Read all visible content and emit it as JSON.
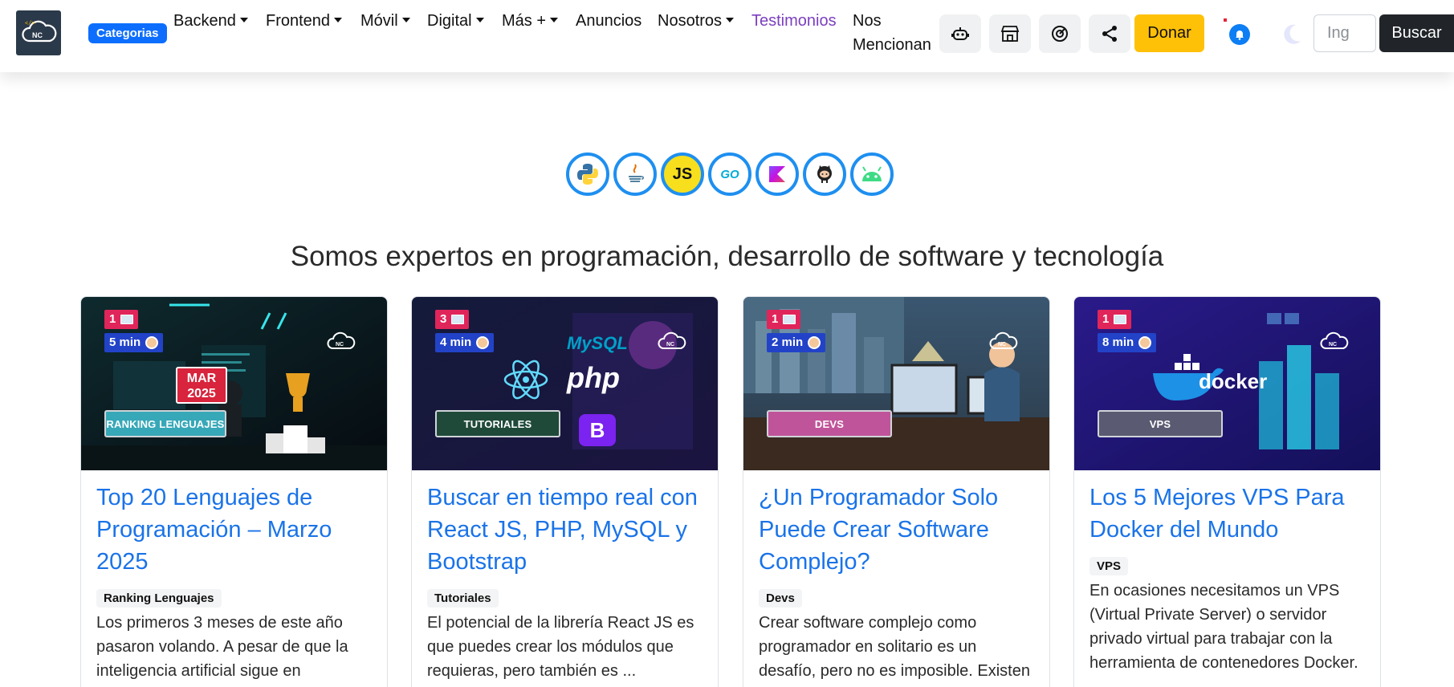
{
  "nav": {
    "categorias": "Categorias",
    "links": [
      {
        "label": "Backend",
        "dropdown": true
      },
      {
        "label": "Frontend",
        "dropdown": true
      },
      {
        "label": "Móvil",
        "dropdown": true
      },
      {
        "label": "Digital",
        "dropdown": true
      },
      {
        "label": "Más +",
        "dropdown": true
      },
      {
        "label": "Anuncios",
        "dropdown": false
      },
      {
        "label": "Nosotros",
        "dropdown": true
      },
      {
        "label": "Testimonios",
        "dropdown": false
      }
    ],
    "nos_line1": "Nos",
    "nos_line2": "Mencionan",
    "icon_buttons": [
      "robot-icon",
      "store-icon",
      "gauge-icon",
      "share-icon"
    ],
    "donar": "Donar",
    "search_placeholder": "Ing",
    "buscar": "Buscar",
    "accent": "#0d6efd",
    "donate_color": "#ffc107"
  },
  "tech_icons": [
    "python-icon",
    "java-icon",
    "javascript-icon",
    "go-icon",
    "kotlin-icon",
    "github-icon",
    "android-icon"
  ],
  "tech_js": "JS",
  "tech_go": "GO",
  "headline": "Somos expertos en programación, desarrollo de software y tecnología",
  "cards": [
    {
      "img_count": "1",
      "read_time": "5 min",
      "img_label": "RANKING LENGUAJES",
      "img_date_1": "MAR",
      "img_date_2": "2025",
      "title": "Top 20 Lenguajes de Programación – Marzo 2025",
      "tag": "Ranking Lenguajes",
      "text": "Los primeros 3 meses de este año pasaron volando. A pesar de que la inteligencia artificial sigue en"
    },
    {
      "img_count": "3",
      "read_time": "4 min",
      "img_label": "TUTORIALES",
      "img_mysql": "MySQL",
      "img_php": "php",
      "img_b": "B",
      "title": "Buscar en tiempo real con React JS, PHP, MySQL y Bootstrap",
      "tag": "Tutoriales",
      "text": "El potencial de la librería React JS es que puedes crear los módulos que requieras, pero también es ..."
    },
    {
      "img_count": "1",
      "read_time": "2 min",
      "img_label": "DEVS",
      "title": "¿Un Programador Solo Puede Crear Software Complejo?",
      "tag": "Devs",
      "text": "Crear software complejo como programador en solitario es un desafío, pero no es imposible. Existen"
    },
    {
      "img_count": "1",
      "read_time": "8 min",
      "img_label": "VPS",
      "img_docker": "docker",
      "title": "Los 5 Mejores VPS Para Docker del Mundo",
      "tag": "VPS",
      "text": "En ocasiones necesitamos un VPS (Virtual Private Server) o servidor privado virtual para trabajar con la herramienta de contenedores Docker."
    }
  ]
}
